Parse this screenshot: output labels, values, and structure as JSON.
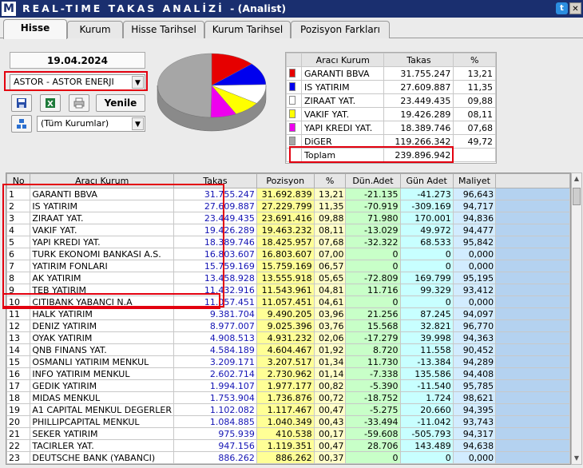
{
  "window": {
    "logo": "M",
    "title": "REAL-TIME TAKAS ANALİZİ",
    "subtitle": "- (Analist)",
    "twitter_icon": "twitter-icon",
    "close_icon": "close-icon"
  },
  "tabs": [
    {
      "label": "Hisse",
      "active": true
    },
    {
      "label": "Kurum",
      "active": false
    },
    {
      "label": "Hisse Tarihsel",
      "active": false
    },
    {
      "label": "Kurum Tarihsel",
      "active": false
    },
    {
      "label": "Pozisyon Farkları",
      "active": false
    }
  ],
  "controls": {
    "date": "19.04.2024",
    "stock_select": "ASTOR - ASTOR ENERJI",
    "institution_filter": "(Tüm Kurumlar)",
    "refresh_label": "Yenile",
    "icons": [
      "save-icon",
      "excel-icon",
      "print-icon",
      "institutions-icon"
    ]
  },
  "colors": {
    "garanti": "#e60000",
    "is_yatirim": "#0000ee",
    "ziraat": "#ffffff",
    "vakif": "#ffff00",
    "yapi_kredi": "#ee00ee",
    "diger": "#a6a6a6",
    "takas_text": "#1414b4",
    "title_bar": "#1a2f6f",
    "highlight": "#e3000f"
  },
  "summary": {
    "headers": [
      "Aracı Kurum",
      "Takas",
      "%"
    ],
    "rows": [
      {
        "name": "GARANTI BBVA",
        "takas": "31.755.247",
        "pct": "13,21",
        "color": "#e60000"
      },
      {
        "name": "IS YATIRIM",
        "takas": "27.609.887",
        "pct": "11,35",
        "color": "#0000ee"
      },
      {
        "name": "ZIRAAT YAT.",
        "takas": "23.449.435",
        "pct": "09,88",
        "color": "#ffffff"
      },
      {
        "name": "VAKIF YAT.",
        "takas": "19.426.289",
        "pct": "08,11",
        "color": "#ffff00"
      },
      {
        "name": "YAPI KREDI YAT.",
        "takas": "18.389.746",
        "pct": "07,68",
        "color": "#ee00ee"
      },
      {
        "name": "DiGER",
        "takas": "119.266.342",
        "pct": "49,72",
        "color": "#a6a6a6"
      }
    ],
    "total_label": "Toplam",
    "total_value": "239.896.942"
  },
  "chart_data": {
    "type": "pie",
    "categories": [
      "GARANTI BBVA",
      "IS YATIRIM",
      "ZIRAAT YAT.",
      "VAKIF YAT.",
      "YAPI KREDI YAT.",
      "DiGER"
    ],
    "values": [
      13.21,
      11.35,
      9.88,
      8.11,
      7.68,
      49.72
    ],
    "colors": [
      "#e60000",
      "#0000ee",
      "#ffffff",
      "#ffff00",
      "#ee00ee",
      "#a6a6a6"
    ],
    "title": ""
  },
  "grid": {
    "headers": [
      "No",
      "Aracı Kurum",
      "Takas",
      "Pozisyon",
      "%",
      "Dün.Adet",
      "Gün Adet",
      "Maliyet"
    ],
    "rows": [
      [
        "1",
        "GARANTI BBVA",
        "31.755.247",
        "31.692.839",
        "13,21",
        "-21.135",
        "-41.273",
        "96,643"
      ],
      [
        "2",
        "IS YATIRIM",
        "27.609.887",
        "27.229.799",
        "11,35",
        "-70.919",
        "-309.169",
        "94,717"
      ],
      [
        "3",
        "ZIRAAT YAT.",
        "23.449.435",
        "23.691.416",
        "09,88",
        "71.980",
        "170.001",
        "94,836"
      ],
      [
        "4",
        "VAKIF YAT.",
        "19.426.289",
        "19.463.232",
        "08,11",
        "-13.029",
        "49.972",
        "94,477"
      ],
      [
        "5",
        "YAPI KREDI YAT.",
        "18.389.746",
        "18.425.957",
        "07,68",
        "-32.322",
        "68.533",
        "95,842"
      ],
      [
        "6",
        "TURK EKONOMI BANKASI A.S.",
        "16.803.607",
        "16.803.607",
        "07,00",
        "0",
        "0",
        "0,000"
      ],
      [
        "7",
        "YATIRIM FONLARI",
        "15.759.169",
        "15.759.169",
        "06,57",
        "0",
        "0",
        "0,000"
      ],
      [
        "8",
        "AK YATIRIM",
        "13.458.928",
        "13.555.918",
        "05,65",
        "-72.809",
        "169.799",
        "95,195"
      ],
      [
        "9",
        "TEB YATIRIM",
        "11.432.916",
        "11.543.961",
        "04,81",
        "11.716",
        "99.329",
        "93,412"
      ],
      [
        "10",
        "CITIBANK YABANCI N.A",
        "11.057.451",
        "11.057.451",
        "04,61",
        "0",
        "0",
        "0,000"
      ],
      [
        "11",
        "HALK YATIRIM",
        "9.381.704",
        "9.490.205",
        "03,96",
        "21.256",
        "87.245",
        "94,097"
      ],
      [
        "12",
        "DENIZ YATIRIM",
        "8.977.007",
        "9.025.396",
        "03,76",
        "15.568",
        "32.821",
        "96,770"
      ],
      [
        "13",
        "OYAK YATIRIM",
        "4.908.513",
        "4.931.232",
        "02,06",
        "-17.279",
        "39.998",
        "94,363"
      ],
      [
        "14",
        "QNB FINANS YAT.",
        "4.584.189",
        "4.604.467",
        "01,92",
        "8.720",
        "11.558",
        "90,452"
      ],
      [
        "15",
        "OSMANLI YATIRIM MENKUL",
        "3.209.171",
        "3.207.517",
        "01,34",
        "11.730",
        "-13.384",
        "94,289"
      ],
      [
        "16",
        "INFO YATIRIM MENKUL",
        "2.602.714",
        "2.730.962",
        "01,14",
        "-7.338",
        "135.586",
        "94,408"
      ],
      [
        "17",
        "GEDIK YATIRIM",
        "1.994.107",
        "1.977.177",
        "00,82",
        "-5.390",
        "-11.540",
        "95,785"
      ],
      [
        "18",
        "MIDAS MENKUL",
        "1.753.904",
        "1.736.876",
        "00,72",
        "-18.752",
        "1.724",
        "98,621"
      ],
      [
        "19",
        "A1 CAPITAL MENKUL DEGERLER",
        "1.102.082",
        "1.117.467",
        "00,47",
        "-5.275",
        "20.660",
        "94,395"
      ],
      [
        "20",
        "PHILLIPCAPITAL MENKUL",
        "1.084.885",
        "1.040.349",
        "00,43",
        "-33.494",
        "-11.042",
        "93,743"
      ],
      [
        "21",
        "SEKER YATIRIM",
        "975.939",
        "410.538",
        "00,17",
        "-59.608",
        "-505.793",
        "94,317"
      ],
      [
        "22",
        "TACIRLER YAT.",
        "947.156",
        "1.119.351",
        "00,47",
        "28.706",
        "143.489",
        "94,638"
      ],
      [
        "23",
        "DEUTSCHE BANK (YABANCI)",
        "886.262",
        "886.262",
        "00,37",
        "0",
        "0",
        "0,000"
      ]
    ]
  }
}
